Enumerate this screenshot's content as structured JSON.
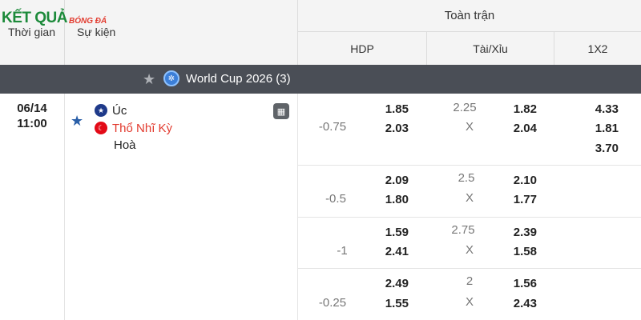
{
  "logo": {
    "main": "KẾT QUẢ",
    "sub": "BÓNG ĐÁ"
  },
  "header": {
    "col_time": "Thời gian",
    "col_event": "Sự kiện",
    "full_match": "Toàn trận",
    "hdp": "HDP",
    "tai_xiu": "Tài/Xỉu",
    "x12": "1X2"
  },
  "league": {
    "name": "World Cup 2026",
    "count": "(3)"
  },
  "match": {
    "date": "06/14",
    "time": "11:00",
    "home": "Úc",
    "away": "Thổ Nhĩ Kỳ",
    "draw_label": "Hoà"
  },
  "odds_rows": [
    {
      "hdp_line": "-0.75",
      "hdp_home": "1.85",
      "hdp_away": "2.03",
      "ou_line": "2.25",
      "ou_x": "X",
      "ou_over": "1.82",
      "ou_under": "2.04",
      "x12_home": "4.33",
      "x12_away": "1.81",
      "x12_draw": "3.70"
    },
    {
      "hdp_line": "-0.5",
      "hdp_home": "2.09",
      "hdp_away": "1.80",
      "ou_line": "2.5",
      "ou_x": "X",
      "ou_over": "2.10",
      "ou_under": "1.77"
    },
    {
      "hdp_line": "-1",
      "hdp_home": "1.59",
      "hdp_away": "2.41",
      "ou_line": "2.75",
      "ou_x": "X",
      "ou_over": "2.39",
      "ou_under": "1.58"
    },
    {
      "hdp_line": "-0.25",
      "hdp_home": "2.49",
      "hdp_away": "1.55",
      "ou_line": "2",
      "ou_x": "X",
      "ou_over": "1.56",
      "ou_under": "2.43"
    }
  ]
}
